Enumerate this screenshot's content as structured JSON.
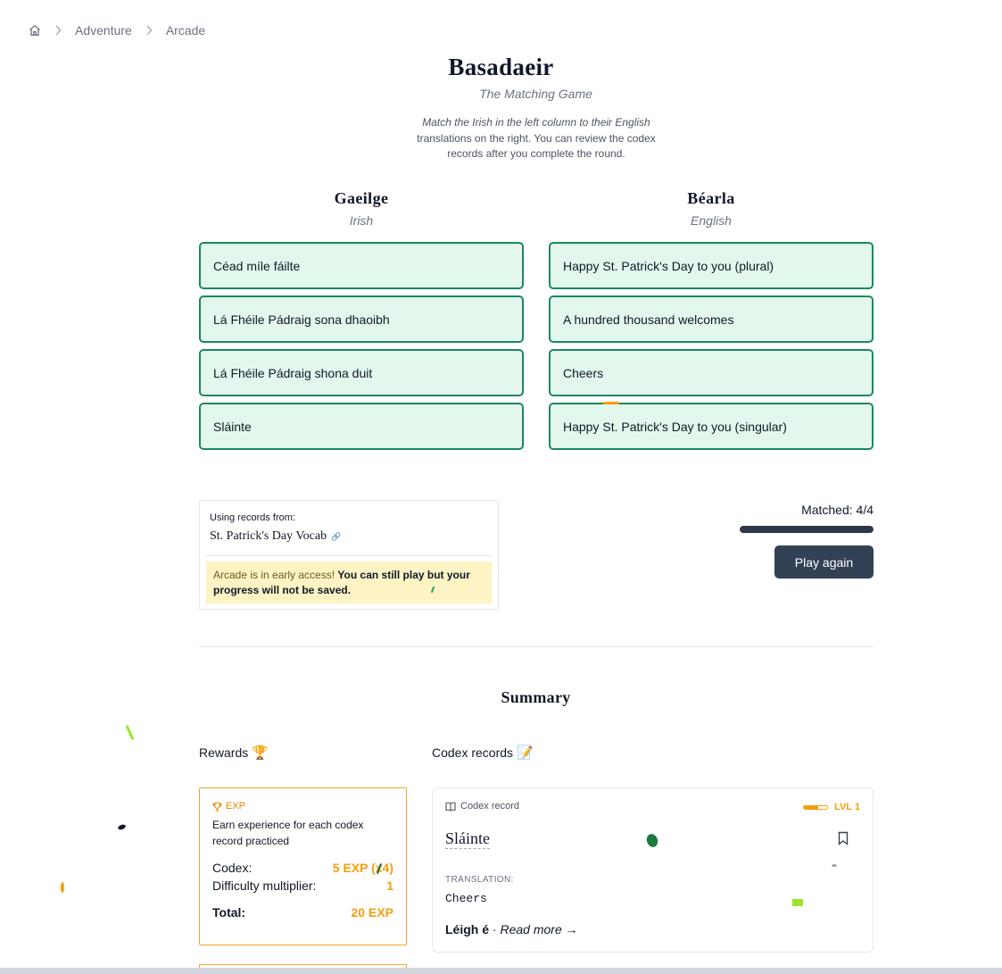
{
  "breadcrumb": {
    "home_icon": "home-icon",
    "items": [
      "Adventure",
      "Arcade"
    ]
  },
  "header": {
    "title": "Basadaeir",
    "subtitle": "The Matching Game",
    "description_italic": "Match the Irish in the left column to their English",
    "description_rest": "translations on the right. You can review the codex records after you complete the round."
  },
  "columns": {
    "left": {
      "heading": "Gaeilge",
      "subheading": "Irish",
      "items": [
        "Céad míle fáilte",
        "Lá Fhéile Pádraig sona dhaoibh",
        "Lá Fhéile Pádraig shona duit",
        "Sláinte"
      ]
    },
    "right": {
      "heading": "Béarla",
      "subheading": "English",
      "items": [
        "Happy St. Patrick's Day to you (plural)",
        "A hundred thousand welcomes",
        "Cheers",
        "Happy St. Patrick's Day to you (singular)"
      ]
    }
  },
  "records": {
    "label": "Using records from:",
    "name": "St. Patrick's Day Vocab",
    "link_icon": "link-icon",
    "notice_plain": "Arcade is in early access!",
    "notice_bold": "You can still play but your progress will not be saved."
  },
  "status": {
    "matched_text": "Matched: 4/4",
    "progress": 1.0,
    "play_again": "Play again"
  },
  "summary": {
    "title": "Summary",
    "rewards_heading": "Rewards",
    "rewards_emoji": "🏆",
    "codex_heading": "Codex records",
    "codex_emoji": "📝"
  },
  "reward_card": {
    "tag": "EXP",
    "icon": "trophy-icon",
    "intro": "Earn experience for each codex record practiced",
    "rows": [
      {
        "label": "Codex:",
        "value": "5 EXP (x4)"
      },
      {
        "label": "Difficulty multiplier:",
        "value": "1"
      }
    ],
    "total_label": "Total:",
    "total_value": "20 EXP"
  },
  "codex_card": {
    "tag": "Codex record",
    "icon": "book-icon",
    "level": "LVL 1",
    "level_progress": 0.6,
    "word": "Sláinte",
    "translation_label": "TRANSLATION:",
    "translation": "Cheers",
    "read_bold": "Léigh é",
    "read_sep": " · ",
    "read_more": "Read more →"
  },
  "colors": {
    "match_bg": "#e3f8ed",
    "match_border": "#1b8a5f",
    "accent": "#f59e0b",
    "button": "#334155"
  }
}
